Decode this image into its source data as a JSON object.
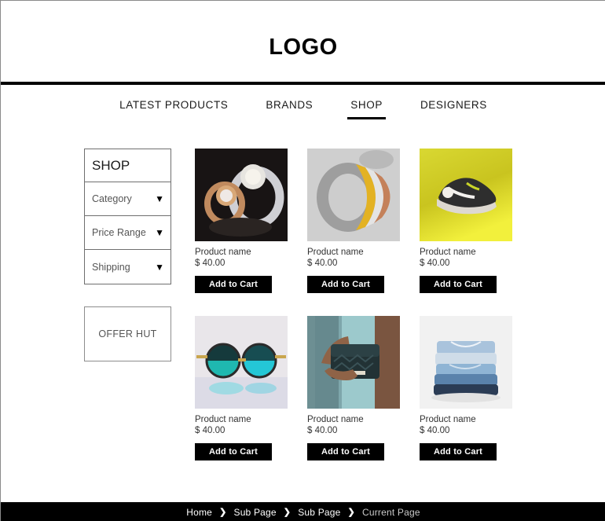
{
  "header": {
    "logo": "LOGO"
  },
  "nav": {
    "items": [
      {
        "label": "LATEST PRODUCTS",
        "active": false
      },
      {
        "label": "BRANDS",
        "active": false
      },
      {
        "label": "SHOP",
        "active": true
      },
      {
        "label": "DESIGNERS",
        "active": false
      }
    ]
  },
  "sidebar": {
    "title": "SHOP",
    "filters": [
      {
        "label": "Category",
        "caret": "▼"
      },
      {
        "label": "Price Range",
        "caret": "▼"
      },
      {
        "label": "Shipping",
        "caret": "▼"
      }
    ],
    "offer": {
      "label": "OFFER HUT"
    }
  },
  "products": [
    {
      "name": "Product name",
      "price": "$ 40.00",
      "button": "Add to Cart",
      "image": "rings-pearl-diamond"
    },
    {
      "name": "Product name",
      "price": "$ 40.00",
      "button": "Add to Cart",
      "image": "ring-multitone-metal"
    },
    {
      "name": "Product name",
      "price": "$ 40.00",
      "button": "Add to Cart",
      "image": "sneaker-on-yellow"
    },
    {
      "name": "Product name",
      "price": "$ 40.00",
      "button": "Add to Cart",
      "image": "round-sunglasses"
    },
    {
      "name": "Product name",
      "price": "$ 40.00",
      "button": "Add to Cart",
      "image": "quilted-handbag"
    },
    {
      "name": "Product name",
      "price": "$ 40.00",
      "button": "Add to Cart",
      "image": "folded-denim-stack"
    }
  ],
  "footer": {
    "breadcrumbs": [
      {
        "label": "Home",
        "current": false
      },
      {
        "label": "Sub Page",
        "current": false
      },
      {
        "label": "Sub Page",
        "current": false
      },
      {
        "label": "Current Page",
        "current": true
      }
    ],
    "separator": "❯"
  },
  "colors": {
    "accent": "#000000",
    "page_bg": "#ffffff",
    "muted_text": "#555555",
    "footer_bg": "#000000"
  }
}
